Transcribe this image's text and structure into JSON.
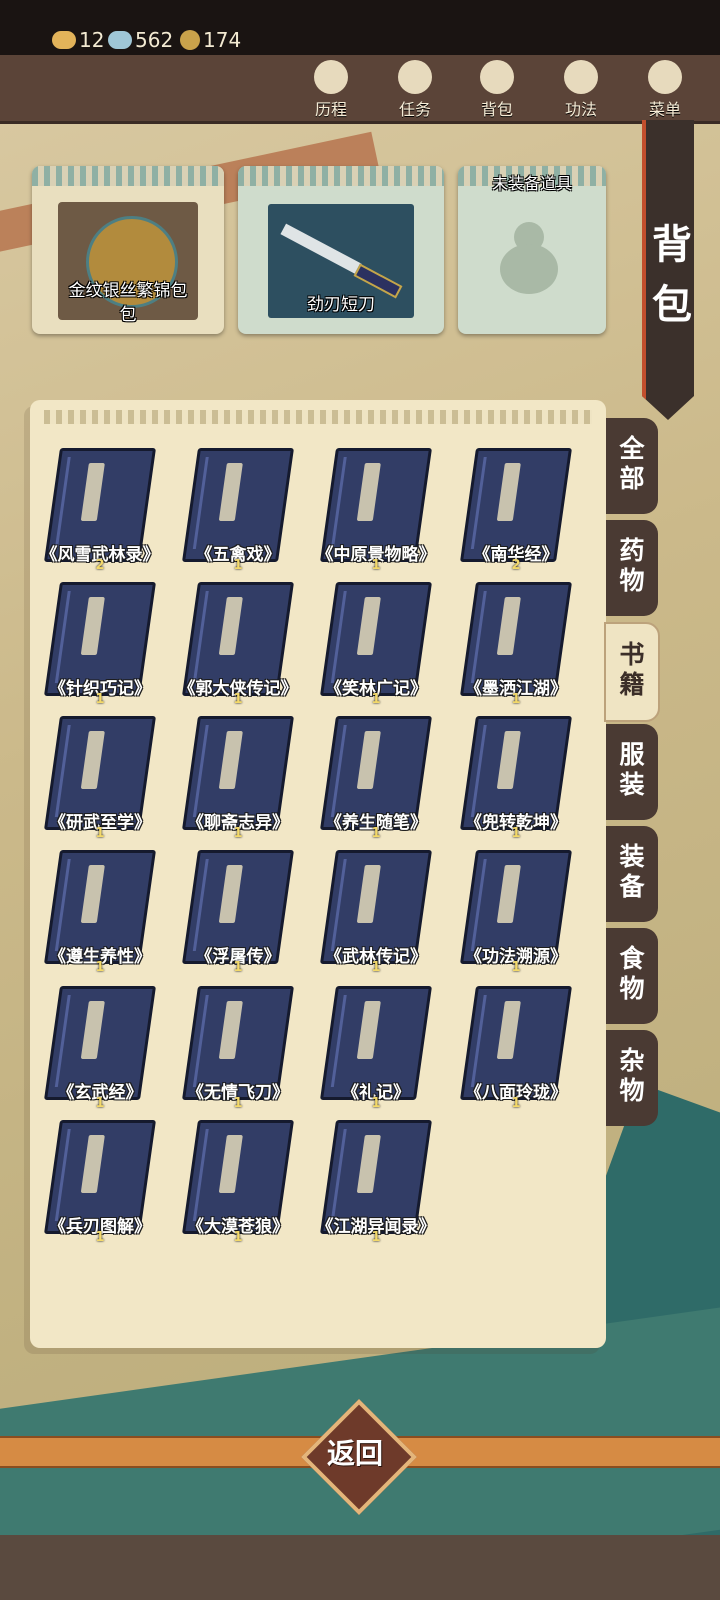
{
  "resources": [
    {
      "icon": "ingot-icon",
      "value": "12"
    },
    {
      "icon": "silver-icon",
      "value": "562"
    },
    {
      "icon": "coin-icon",
      "value": "174"
    }
  ],
  "nav": [
    {
      "label": "历程",
      "icon": "journey-icon"
    },
    {
      "label": "任务",
      "icon": "quest-scroll-icon"
    },
    {
      "label": "背包",
      "icon": "bag-icon"
    },
    {
      "label": "功法",
      "icon": "scroll-icon"
    },
    {
      "label": "菜单",
      "icon": "fan-icon"
    }
  ],
  "banner": {
    "char1": "背",
    "char2": "包"
  },
  "equipped": [
    {
      "label": "金纹银丝繁锦包",
      "label_line2": "",
      "header": ""
    },
    {
      "label": "劲刃短刀",
      "header": ""
    },
    {
      "label": "",
      "header": "未装备道具"
    }
  ],
  "items": [
    {
      "name": "《风雪武林录》",
      "count": "2"
    },
    {
      "name": "《五禽戏》",
      "count": "1"
    },
    {
      "name": "《中原景物略》",
      "count": "1"
    },
    {
      "name": "《南华经》",
      "count": "2"
    },
    {
      "name": "《针织巧记》",
      "count": "1"
    },
    {
      "name": "《郭大侠传记》",
      "count": "1"
    },
    {
      "name": "《笑林广记》",
      "count": "1"
    },
    {
      "name": "《墨洒江湖》",
      "count": "1"
    },
    {
      "name": "《研武至学》",
      "count": "1"
    },
    {
      "name": "《聊斋志异》",
      "count": "1"
    },
    {
      "name": "《养生随笔》",
      "count": "1"
    },
    {
      "name": "《兜转乾坤》",
      "count": "1"
    },
    {
      "name": "《遵生养性》",
      "count": "1"
    },
    {
      "name": "《浮屠传》",
      "count": "1"
    },
    {
      "name": "《武林传记》",
      "count": "1"
    },
    {
      "name": "《功法溯源》",
      "count": "1"
    },
    {
      "name": "《玄武经》",
      "count": "1"
    },
    {
      "name": "《无情飞刀》",
      "count": "1"
    },
    {
      "name": "《礼记》",
      "count": "1"
    },
    {
      "name": "《八面玲珑》",
      "count": "1"
    },
    {
      "name": "《兵刃图解》",
      "count": "1"
    },
    {
      "name": "《大漠苍狼》",
      "count": "1"
    },
    {
      "name": "《江湖异闻录》",
      "count": "1"
    }
  ],
  "tabs": [
    {
      "label": "全部"
    },
    {
      "label": "药物"
    },
    {
      "label": "书籍",
      "active": true
    },
    {
      "label": "服装"
    },
    {
      "label": "装备"
    },
    {
      "label": "食物"
    },
    {
      "label": "杂物"
    }
  ],
  "return_label": "返回",
  "colors": {
    "topbar": "#5b4438",
    "tab_dark": "#4a3a33",
    "panel": "#f2e7c6",
    "book": "#323d66",
    "accent": "#c24f2d"
  }
}
